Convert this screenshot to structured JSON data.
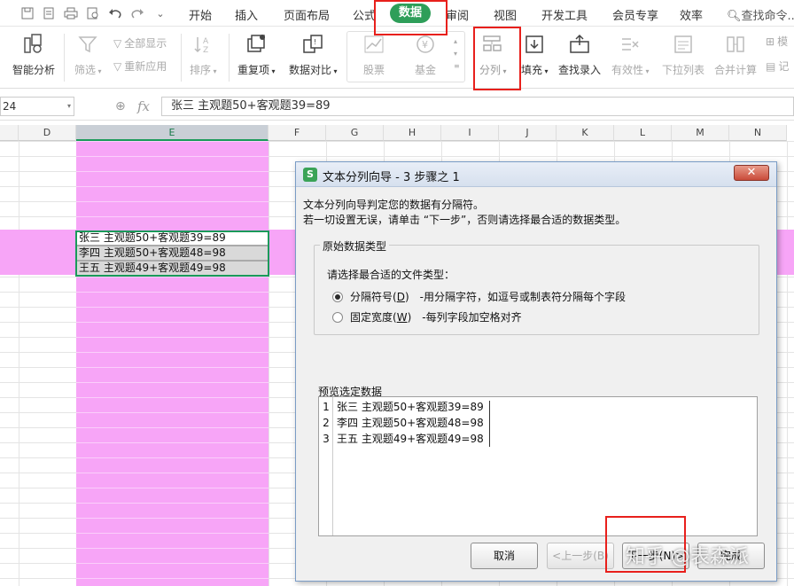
{
  "menubar": {
    "quick_access": [
      "save-icon",
      "pdf-export-icon",
      "print-icon",
      "print-preview-icon",
      "undo-icon",
      "redo-icon",
      "more-icon"
    ],
    "tabs": [
      "开始",
      "插入",
      "页面布局",
      "公式",
      "数据",
      "审阅",
      "视图",
      "开发工具",
      "会员专享",
      "效率"
    ],
    "active_tab": "数据",
    "search_label": "查找命令..."
  },
  "ribbon": {
    "smart_analysis": "智能分析",
    "filter": "筛选",
    "show_all": "全部显示",
    "reapply": "重新应用",
    "sort": "排序",
    "duplicates": "重复项",
    "data_compare": "数据对比",
    "stock": "股票",
    "fund": "基金",
    "split_column": "分列",
    "fill": "填充",
    "find_entry": "查找录入",
    "validity": "有效性",
    "dropdown_list": "下拉列表",
    "consolidate": "合并计算",
    "record": "记",
    "model": "模"
  },
  "formula_bar": {
    "name_box": "24",
    "fx_label": "fx",
    "formula": "张三  主观题50+客观题39=89"
  },
  "columns": [
    "D",
    "E",
    "F",
    "G",
    "H",
    "I",
    "J",
    "K",
    "L",
    "M",
    "N"
  ],
  "cells": [
    "张三  主观题50+客观题39=89",
    "李四  主观题50+客观题48=98",
    "王五  主观题49+客观题49=98"
  ],
  "dialog": {
    "title": "文本分列向导 - 3 步骤之 1",
    "intro_line1": "文本分列向导判定您的数据有分隔符。",
    "intro_line2": "若一切设置无误，请单击 “下一步”，否则请选择最合适的数据类型。",
    "group_title": "原始数据类型",
    "choose_prompt": "请选择最合适的文件类型：",
    "option_delimited": "分隔符号(",
    "option_delimited_key": "D",
    "option_delimited_desc": "-用分隔字符，如逗号或制表符分隔每个字段",
    "option_fixed": "固定宽度(",
    "option_fixed_key": "W",
    "option_fixed_desc": "-每列字段加空格对齐",
    "preview_title": "预览选定数据",
    "preview_rows": [
      {
        "num": "1",
        "text": "张三  主观题50+客观题39=89"
      },
      {
        "num": "2",
        "text": "李四  主观题50+客观题48=98"
      },
      {
        "num": "3",
        "text": "王五  主观题49+客观题49=98"
      }
    ],
    "btn_cancel": "取消",
    "btn_back": "<上一步(B)",
    "btn_next": "下一步(N)>",
    "btn_finish": "完成"
  },
  "watermark": "知乎 @表森派",
  "colors": {
    "highlight": "#f7a5f7",
    "selection": "#1a9a5a",
    "active_tab": "#2e9e59",
    "annotation": "#e8201c"
  }
}
